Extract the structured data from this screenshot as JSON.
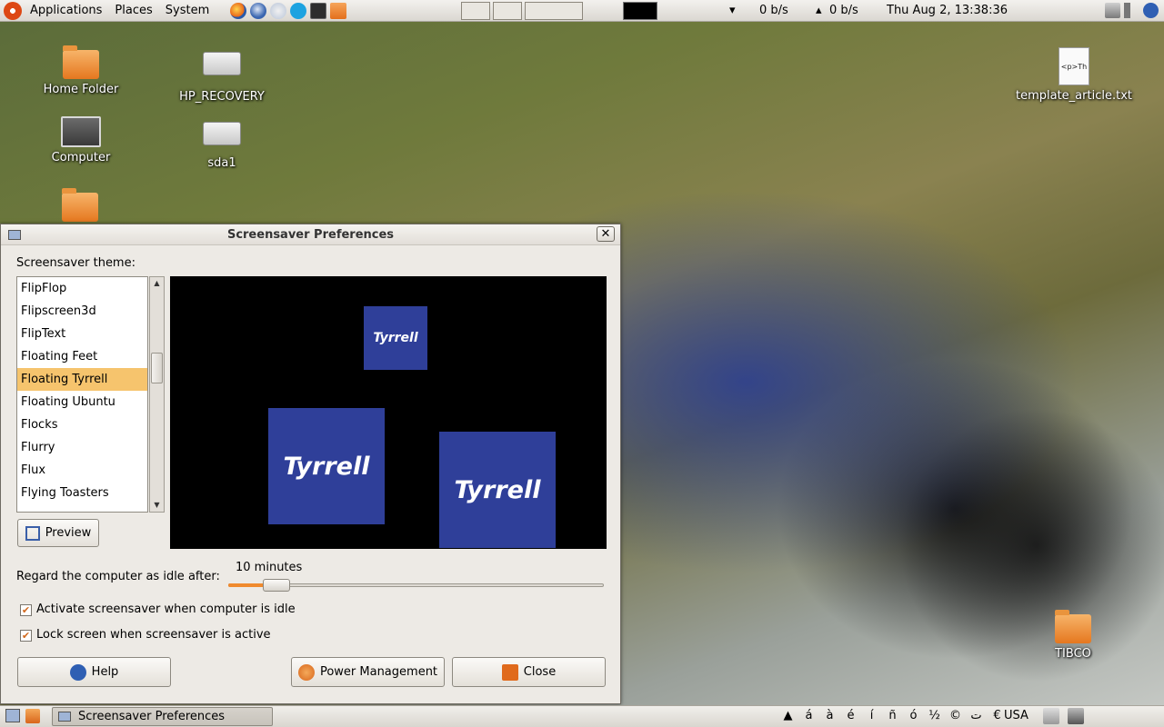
{
  "top_panel": {
    "menus": [
      "Applications",
      "Places",
      "System"
    ],
    "net_down": "0 b/s",
    "net_up": "0 b/s",
    "clock": "Thu Aug  2, 13:38:36"
  },
  "desktop": {
    "icons": [
      "Home Folder",
      "HP_RECOVERY",
      "Computer",
      "sda1",
      "template_article.txt",
      "TIBCO"
    ],
    "file_preview_text": "<p>Th"
  },
  "dialog": {
    "title": "Screensaver Preferences",
    "close_glyph": "✕",
    "theme_label": "Screensaver theme:",
    "themes": [
      "FlipFlop",
      "Flipscreen3d",
      "FlipText",
      "Floating Feet",
      "Floating Tyrrell",
      "Floating Ubuntu",
      "Flocks",
      "Flurry",
      "Flux",
      "Flying Toasters"
    ],
    "selected_theme": "Floating Tyrrell",
    "preview_logo": "Tyrrell",
    "preview_button": "Preview",
    "idle_label": "Regard the computer as idle after:",
    "idle_value": "10 minutes",
    "idle_slider_fraction": 0.1,
    "activate_label": "Activate screensaver when computer is idle",
    "activate_checked": true,
    "lock_label": "Lock screen when screensaver is active",
    "lock_checked": true,
    "help_button": "Help",
    "power_button": "Power Management",
    "close_button": "Close"
  },
  "bottom_panel": {
    "task": "Screensaver Preferences",
    "chars": [
      "▲",
      "á",
      "à",
      "é",
      "í",
      "ñ",
      "ó",
      "½",
      "©",
      "ت",
      "€"
    ],
    "keyboard_layout": "USA"
  },
  "colors": {
    "selection": "#f6c46d",
    "accent": "#f08a2e",
    "tyrrell_blue": "#2f3f99"
  }
}
